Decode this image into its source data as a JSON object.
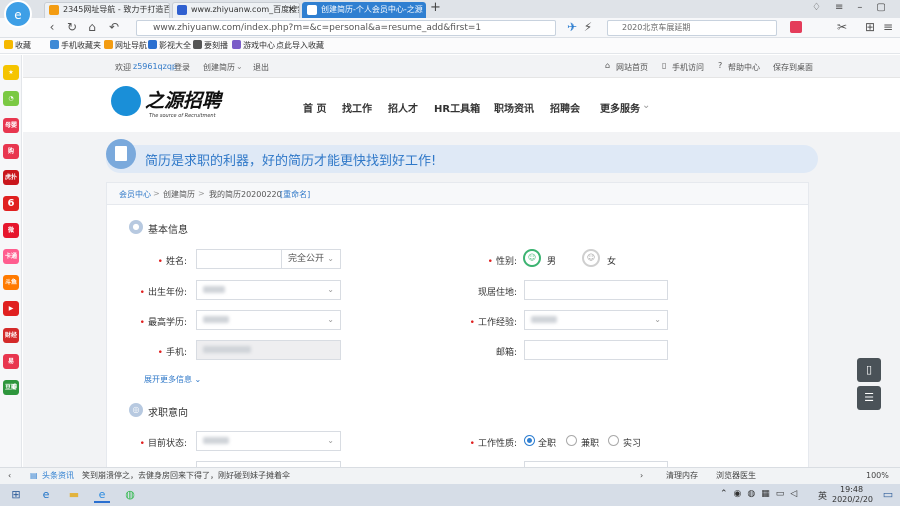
{
  "browser": {
    "tabs": [
      {
        "title": "2345网址导航 - 致力于打造百"
      },
      {
        "title": "www.zhiyuanw.com_百度搜索"
      },
      {
        "title": "创建简历-个人会员中心-之源"
      }
    ],
    "new_tab": "+",
    "address": "www.zhiyuanw.com/index.php?m=&c=personal&a=resume_add&first=1",
    "search_hint": "2020北京车展延期",
    "bookmarks": [
      "收藏",
      "手机收藏夹",
      "网址导航",
      "影视大全",
      "要刻播",
      "游戏中心",
      "点此导入收藏"
    ],
    "sidebar_labels": [
      "",
      "",
      "母婴",
      "",
      "虎扑",
      "",
      "",
      "卡通",
      "斗鱼",
      "",
      "财经",
      "",
      "豆瓣"
    ],
    "status": {
      "news_label": "头条资讯",
      "news_text": "笑到崩溃停之，去健身房回来下得了，刚好碰到妹子摊着伞",
      "clean": "清理内存",
      "accel": "浏览器医生",
      "zoom": "100%"
    },
    "taskbar": {
      "time": "19:48",
      "date": "2020/2/20",
      "ime": "英"
    }
  },
  "site": {
    "welcome": "欢迎",
    "username": "z5961qzqp",
    "login": "登录",
    "create_resume": "创建简历",
    "logout": "退出",
    "top_links": [
      "网站首页",
      "手机访问",
      "帮助中心",
      "保存到桌面"
    ],
    "logo_main": "之源招聘",
    "logo_sub": "The source of Recruitment",
    "nav": [
      "首 页",
      "找工作",
      "招人才",
      "HR工具箱",
      "职场资讯",
      "招聘会",
      "更多服务"
    ]
  },
  "banner": {
    "text": "简历是求职的利器，好的简历才能更快找到好工作!"
  },
  "breadcrumb": {
    "items": [
      "会员中心",
      "创建简历",
      "我的简历20200220"
    ],
    "rename": "[重命名]"
  },
  "basic": {
    "title": "基本信息",
    "name_label": "姓名:",
    "name_visibility": "完全公开",
    "gender_label": "性别:",
    "gender_male": "男",
    "gender_female": "女",
    "birth_label": "出生年份:",
    "address_label": "现居住地:",
    "edu_label": "最高学历:",
    "exp_label": "工作经验:",
    "phone_label": "手机:",
    "email_label": "邮箱:",
    "more": "展开更多信息"
  },
  "intent": {
    "title": "求职意向",
    "status_label": "目前状态:",
    "nature_label": "工作性质:",
    "nature_options": [
      "全职",
      "兼职",
      "实习"
    ]
  },
  "colors": {
    "accent": "#2f7fd1",
    "banner_text": "#2f78c8",
    "required": "#e02020"
  }
}
